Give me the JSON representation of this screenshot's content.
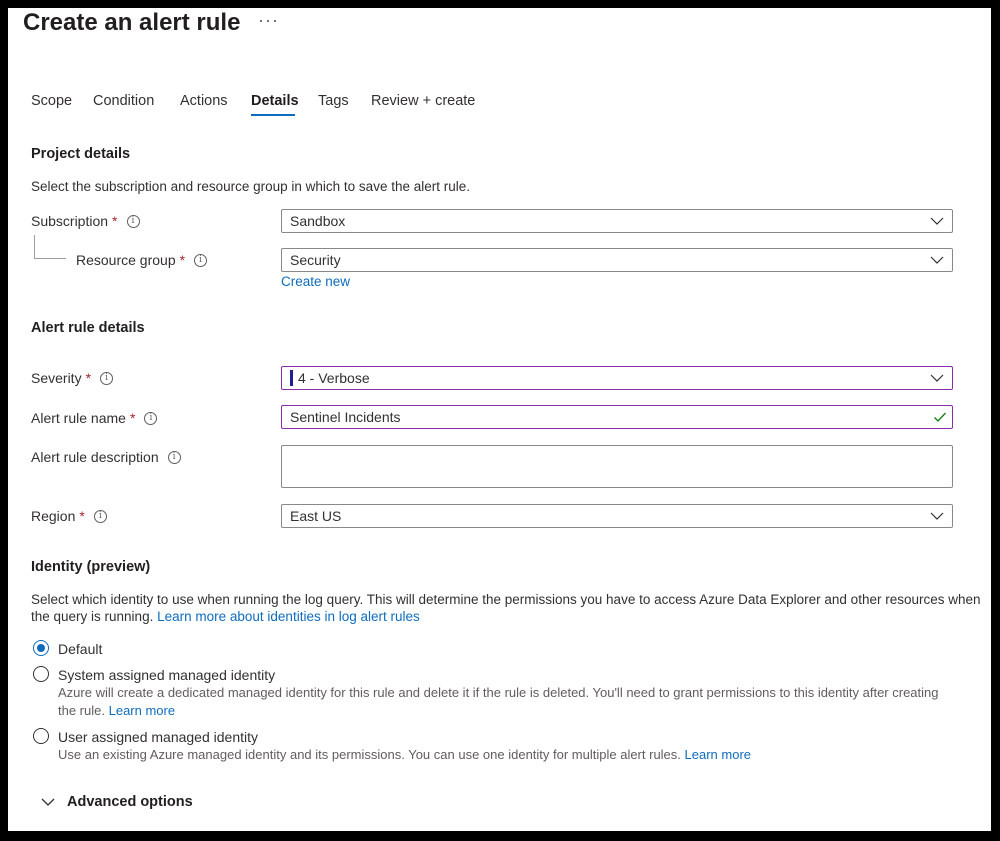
{
  "header": {
    "title": "Create an alert rule",
    "more_label": "···"
  },
  "tabs": [
    {
      "label": "Scope"
    },
    {
      "label": "Condition"
    },
    {
      "label": "Actions"
    },
    {
      "label": "Details",
      "active": true
    },
    {
      "label": "Tags"
    },
    {
      "label": "Review + create"
    }
  ],
  "project": {
    "heading": "Project details",
    "description": "Select the subscription and resource group in which to save the alert rule.",
    "subscription": {
      "label": "Subscription",
      "required": "*",
      "value": "Sandbox"
    },
    "resource_group": {
      "label": "Resource group",
      "required": "*",
      "value": "Security",
      "create_new": "Create new"
    }
  },
  "alert": {
    "heading": "Alert rule details",
    "severity": {
      "label": "Severity",
      "required": "*",
      "value": "4 - Verbose"
    },
    "name": {
      "label": "Alert rule name",
      "required": "*",
      "value": "Sentinel Incidents"
    },
    "description": {
      "label": "Alert rule description",
      "value": ""
    },
    "region": {
      "label": "Region",
      "required": "*",
      "value": "East US"
    }
  },
  "identity": {
    "heading": "Identity (preview)",
    "description_line1": "Select which identity to use when running the log query. This will determine the permissions you have to access Azure Data Explorer and other resources when",
    "description_line2": "the query is running.",
    "learn_more_link": "Learn more about identities in log alert rules",
    "options": [
      {
        "label": "Default",
        "checked": true
      },
      {
        "label": "System assigned managed identity",
        "checked": false,
        "desc_line1": "Azure will create a dedicated managed identity for this rule and delete it if the rule is deleted. You'll need to grant permissions to this identity after creating",
        "desc_line2": "the rule.",
        "learn_more": "Learn more"
      },
      {
        "label": "User assigned managed identity",
        "checked": false,
        "desc_line1": "Use an existing Azure managed identity and its permissions. You can use one identity for multiple alert rules.",
        "learn_more": "Learn more"
      }
    ]
  },
  "advanced": {
    "label": "Advanced options"
  },
  "icons": {
    "info": "info-icon",
    "chevron": "chevron-down-icon",
    "check": "checkmark-icon"
  },
  "colors": {
    "accent": "#0f6cbd",
    "required": "#a4262c",
    "focus_border": "#8b2ba6",
    "valid": "#107c10"
  }
}
